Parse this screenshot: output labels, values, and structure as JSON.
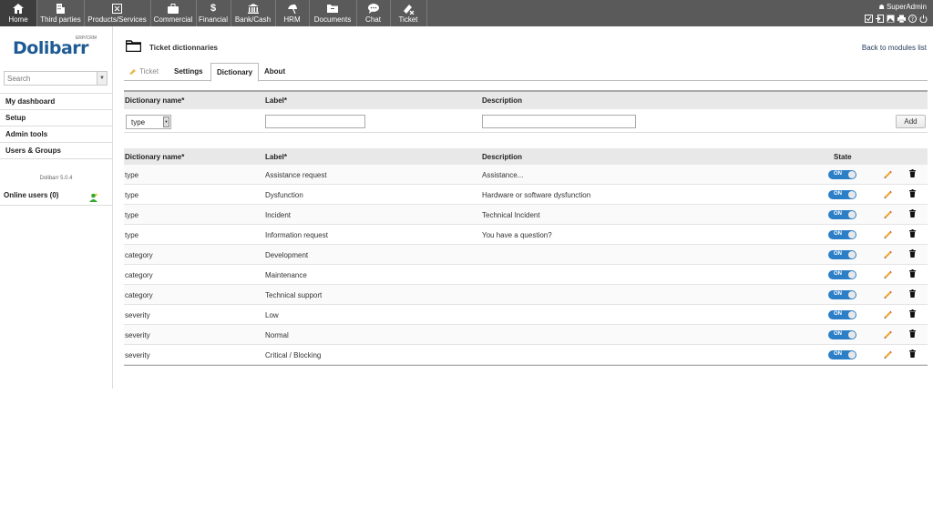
{
  "topmenu": {
    "items": [
      {
        "label": "Home",
        "icon": "home-icon"
      },
      {
        "label": "Third parties",
        "icon": "building-icon"
      },
      {
        "label": "Products/Services",
        "icon": "cube-icon"
      },
      {
        "label": "Commercial",
        "icon": "briefcase-icon"
      },
      {
        "label": "Financial",
        "icon": "dollar-icon"
      },
      {
        "label": "Bank/Cash",
        "icon": "bank-icon"
      },
      {
        "label": "HRM",
        "icon": "umbrella-icon"
      },
      {
        "label": "Documents",
        "icon": "folder-icon"
      },
      {
        "label": "Chat",
        "icon": "chat-icon"
      },
      {
        "label": "Ticket",
        "icon": "ticket-icon"
      }
    ],
    "user": "SuperAdmin"
  },
  "sidebar": {
    "logo_text": "Dolibarr",
    "logo_sub": "ERP/CRM",
    "search_placeholder": "Search",
    "menu": [
      "My dashboard",
      "Setup",
      "Admin tools",
      "Users & Groups"
    ],
    "version": "Dolibarr 5.0.4",
    "online_users": "Online users (0)"
  },
  "page": {
    "title": "Ticket dictionnaries",
    "back_link": "Back to modules list",
    "tabs": {
      "module": "Ticket",
      "settings": "Settings",
      "dictionary": "Dictionary",
      "about": "About"
    }
  },
  "add_form": {
    "col_dict": "Dictionary name*",
    "col_label": "Label*",
    "col_desc": "Description",
    "selected_type": "type",
    "add_label": "Add"
  },
  "list": {
    "col_dict": "Dictionary name*",
    "col_label": "Label*",
    "col_desc": "Description",
    "col_state": "State",
    "on_label": "ON",
    "rows": [
      {
        "dict": "type",
        "label": "Assistance request",
        "desc": "Assistance..."
      },
      {
        "dict": "type",
        "label": "Dysfunction",
        "desc": "Hardware or software dysfunction"
      },
      {
        "dict": "type",
        "label": "Incident",
        "desc": "Technical Incident"
      },
      {
        "dict": "type",
        "label": "Information request",
        "desc": "You have a question?"
      },
      {
        "dict": "category",
        "label": "Development",
        "desc": ""
      },
      {
        "dict": "category",
        "label": "Maintenance",
        "desc": ""
      },
      {
        "dict": "category",
        "label": "Technical support",
        "desc": ""
      },
      {
        "dict": "severity",
        "label": "Low",
        "desc": ""
      },
      {
        "dict": "severity",
        "label": "Normal",
        "desc": ""
      },
      {
        "dict": "severity",
        "label": "Critical / Blocking",
        "desc": ""
      }
    ]
  },
  "colors": {
    "topbar": "#5a5a5a",
    "logo": "#1e5b95",
    "toggle_on": "#2c7fc7",
    "link": "#263c5c"
  }
}
